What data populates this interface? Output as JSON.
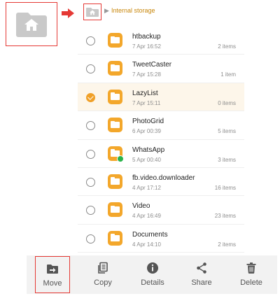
{
  "breadcrumb": {
    "location": "Internal storage"
  },
  "files": [
    {
      "name": "htbackup",
      "date": "7 Apr 16:52",
      "count": "2 items",
      "selected": false
    },
    {
      "name": "TweetCaster",
      "date": "7 Apr 15:28",
      "count": "1 item",
      "selected": false
    },
    {
      "name": "LazyList",
      "date": "7 Apr 15:11",
      "count": "0 items",
      "selected": true
    },
    {
      "name": "PhotoGrid",
      "date": "6 Apr 00:39",
      "count": "5 items",
      "selected": false
    },
    {
      "name": "WhatsApp",
      "date": "5 Apr 00:40",
      "count": "3 items",
      "selected": false,
      "badge": "whatsapp-icon"
    },
    {
      "name": "fb.video.downloader",
      "date": "4 Apr 17:12",
      "count": "16 items",
      "selected": false
    },
    {
      "name": "Video",
      "date": "4 Apr 16:49",
      "count": "23 items",
      "selected": false
    },
    {
      "name": "Documents",
      "date": "4 Apr 14:10",
      "count": "2 items",
      "selected": false
    }
  ],
  "actions": {
    "move": "Move",
    "copy": "Copy",
    "details": "Details",
    "share": "Share",
    "delete": "Delete"
  },
  "colors": {
    "folder": "#f3a72b",
    "accent": "#f0a028",
    "highlight_box": "#e53935",
    "selected_row": "#fdf6ea"
  }
}
